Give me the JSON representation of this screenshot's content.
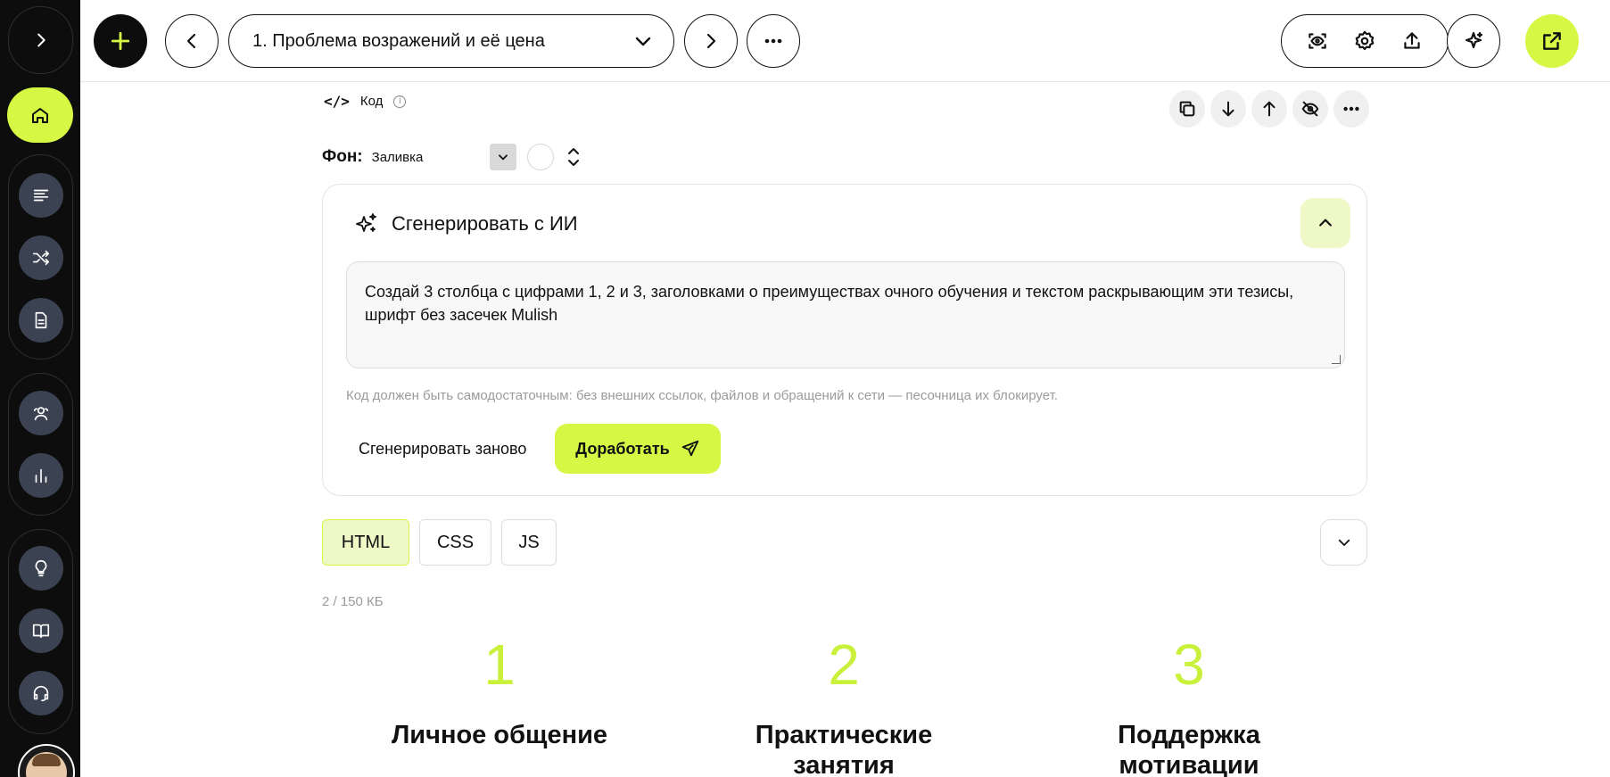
{
  "topbar": {
    "lesson_title": "1. Проблема возражений и её цена"
  },
  "editor": {
    "block_label": "Код",
    "background_label": "Фон:",
    "background_value": "Заливка"
  },
  "ai": {
    "title": "Сгенерировать с ИИ",
    "prompt": "Создай 3 столбца с цифрами 1, 2 и 3, заголовками о преимуществах очного обучения и текстом раскрывающим эти тезисы, шрифт без засечек Mulish",
    "hint": "Код должен быть самодостаточным: без внешних ссылок, файлов и обращений к сети — песочница их блокирует.",
    "regenerate_label": "Сгенерировать заново",
    "refine_label": "Доработать"
  },
  "tabs": [
    {
      "label": "HTML",
      "active": true
    },
    {
      "label": "CSS",
      "active": false
    },
    {
      "label": "JS",
      "active": false
    }
  ],
  "size_info": "2 / 150 КБ",
  "preview": {
    "columns": [
      {
        "number": "1",
        "heading": "Личное общение"
      },
      {
        "number": "2",
        "heading": "Практические занятия"
      },
      {
        "number": "3",
        "heading": "Поддержка мотивации"
      }
    ]
  },
  "colors": {
    "accent": "#d6f744",
    "accent_light": "#eff8c7",
    "sidebar_bg": "#0d0d0d",
    "number_color": "#c9f03b"
  }
}
